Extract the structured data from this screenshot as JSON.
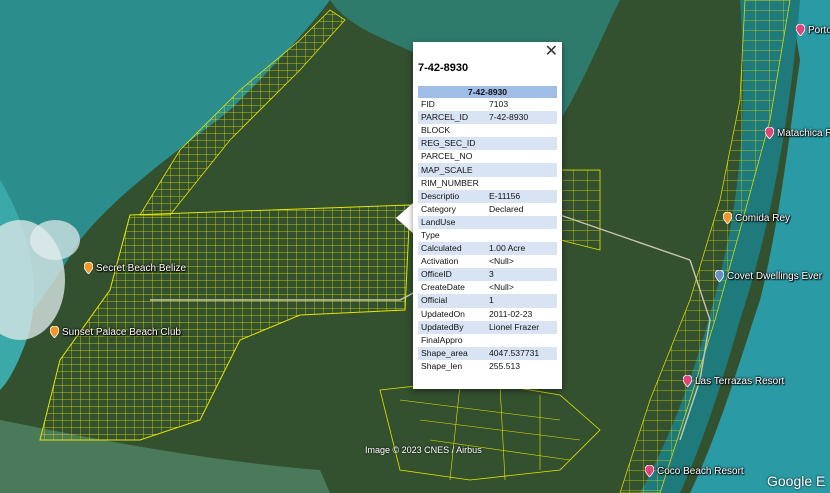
{
  "popup": {
    "title": "7-42-8930",
    "table_caption": "7-42-8930",
    "close_label": "✕",
    "rows": [
      {
        "key": "FID",
        "value": "7103"
      },
      {
        "key": "PARCEL_ID",
        "value": "7-42-8930"
      },
      {
        "key": "BLOCK",
        "value": ""
      },
      {
        "key": "REG_SEC_ID",
        "value": ""
      },
      {
        "key": "PARCEL_NO",
        "value": ""
      },
      {
        "key": "MAP_SCALE",
        "value": ""
      },
      {
        "key": "RIM_NUMBER",
        "value": ""
      },
      {
        "key": "Descriptio",
        "value": "E-11156"
      },
      {
        "key": "Category",
        "value": "Declared"
      },
      {
        "key": "LandUse",
        "value": ""
      },
      {
        "key": "Type",
        "value": ""
      },
      {
        "key": "Calculated",
        "value": "1.00 Acre"
      },
      {
        "key": "Activation",
        "value": "<Null>"
      },
      {
        "key": "OfficeID",
        "value": "3"
      },
      {
        "key": "CreateDate",
        "value": "<Null>"
      },
      {
        "key": "Official",
        "value": "1"
      },
      {
        "key": "UpdatedOn",
        "value": "2011-02-23"
      },
      {
        "key": "UpdatedBy",
        "value": "Lionel Frazer"
      },
      {
        "key": "FinalAppro",
        "value": ""
      },
      {
        "key": "Shape_area",
        "value": "4047.537731"
      },
      {
        "key": "Shape_len",
        "value": "255.513"
      }
    ]
  },
  "places": [
    {
      "name": "Secret Beach Belize",
      "pin": "orange"
    },
    {
      "name": "Sunset Palace Beach Club",
      "pin": "orange"
    },
    {
      "name": "Comida Rey",
      "pin": "orange"
    },
    {
      "name": "Covet Dwellings Ever",
      "pin": "blue"
    },
    {
      "name": "Matachica Re",
      "pin": "pink"
    },
    {
      "name": "Las Terrazas Resort",
      "pin": "pink"
    },
    {
      "name": "Coco Beach Resort",
      "pin": "pink"
    },
    {
      "name": "Portofi",
      "pin": "pink"
    }
  ],
  "attribution": "Image © 2023 CNES / Airbus",
  "logo": "Google E",
  "colors": {
    "parcel": "#e6e600",
    "sea": "#2a8f94",
    "land": "#2f4a2c",
    "popup_header": "#9fbde6",
    "row_alt": "#d8e4f4",
    "pin_orange": "#f0962a",
    "pin_pink": "#e0457a",
    "pin_blue": "#6b8fc4"
  }
}
